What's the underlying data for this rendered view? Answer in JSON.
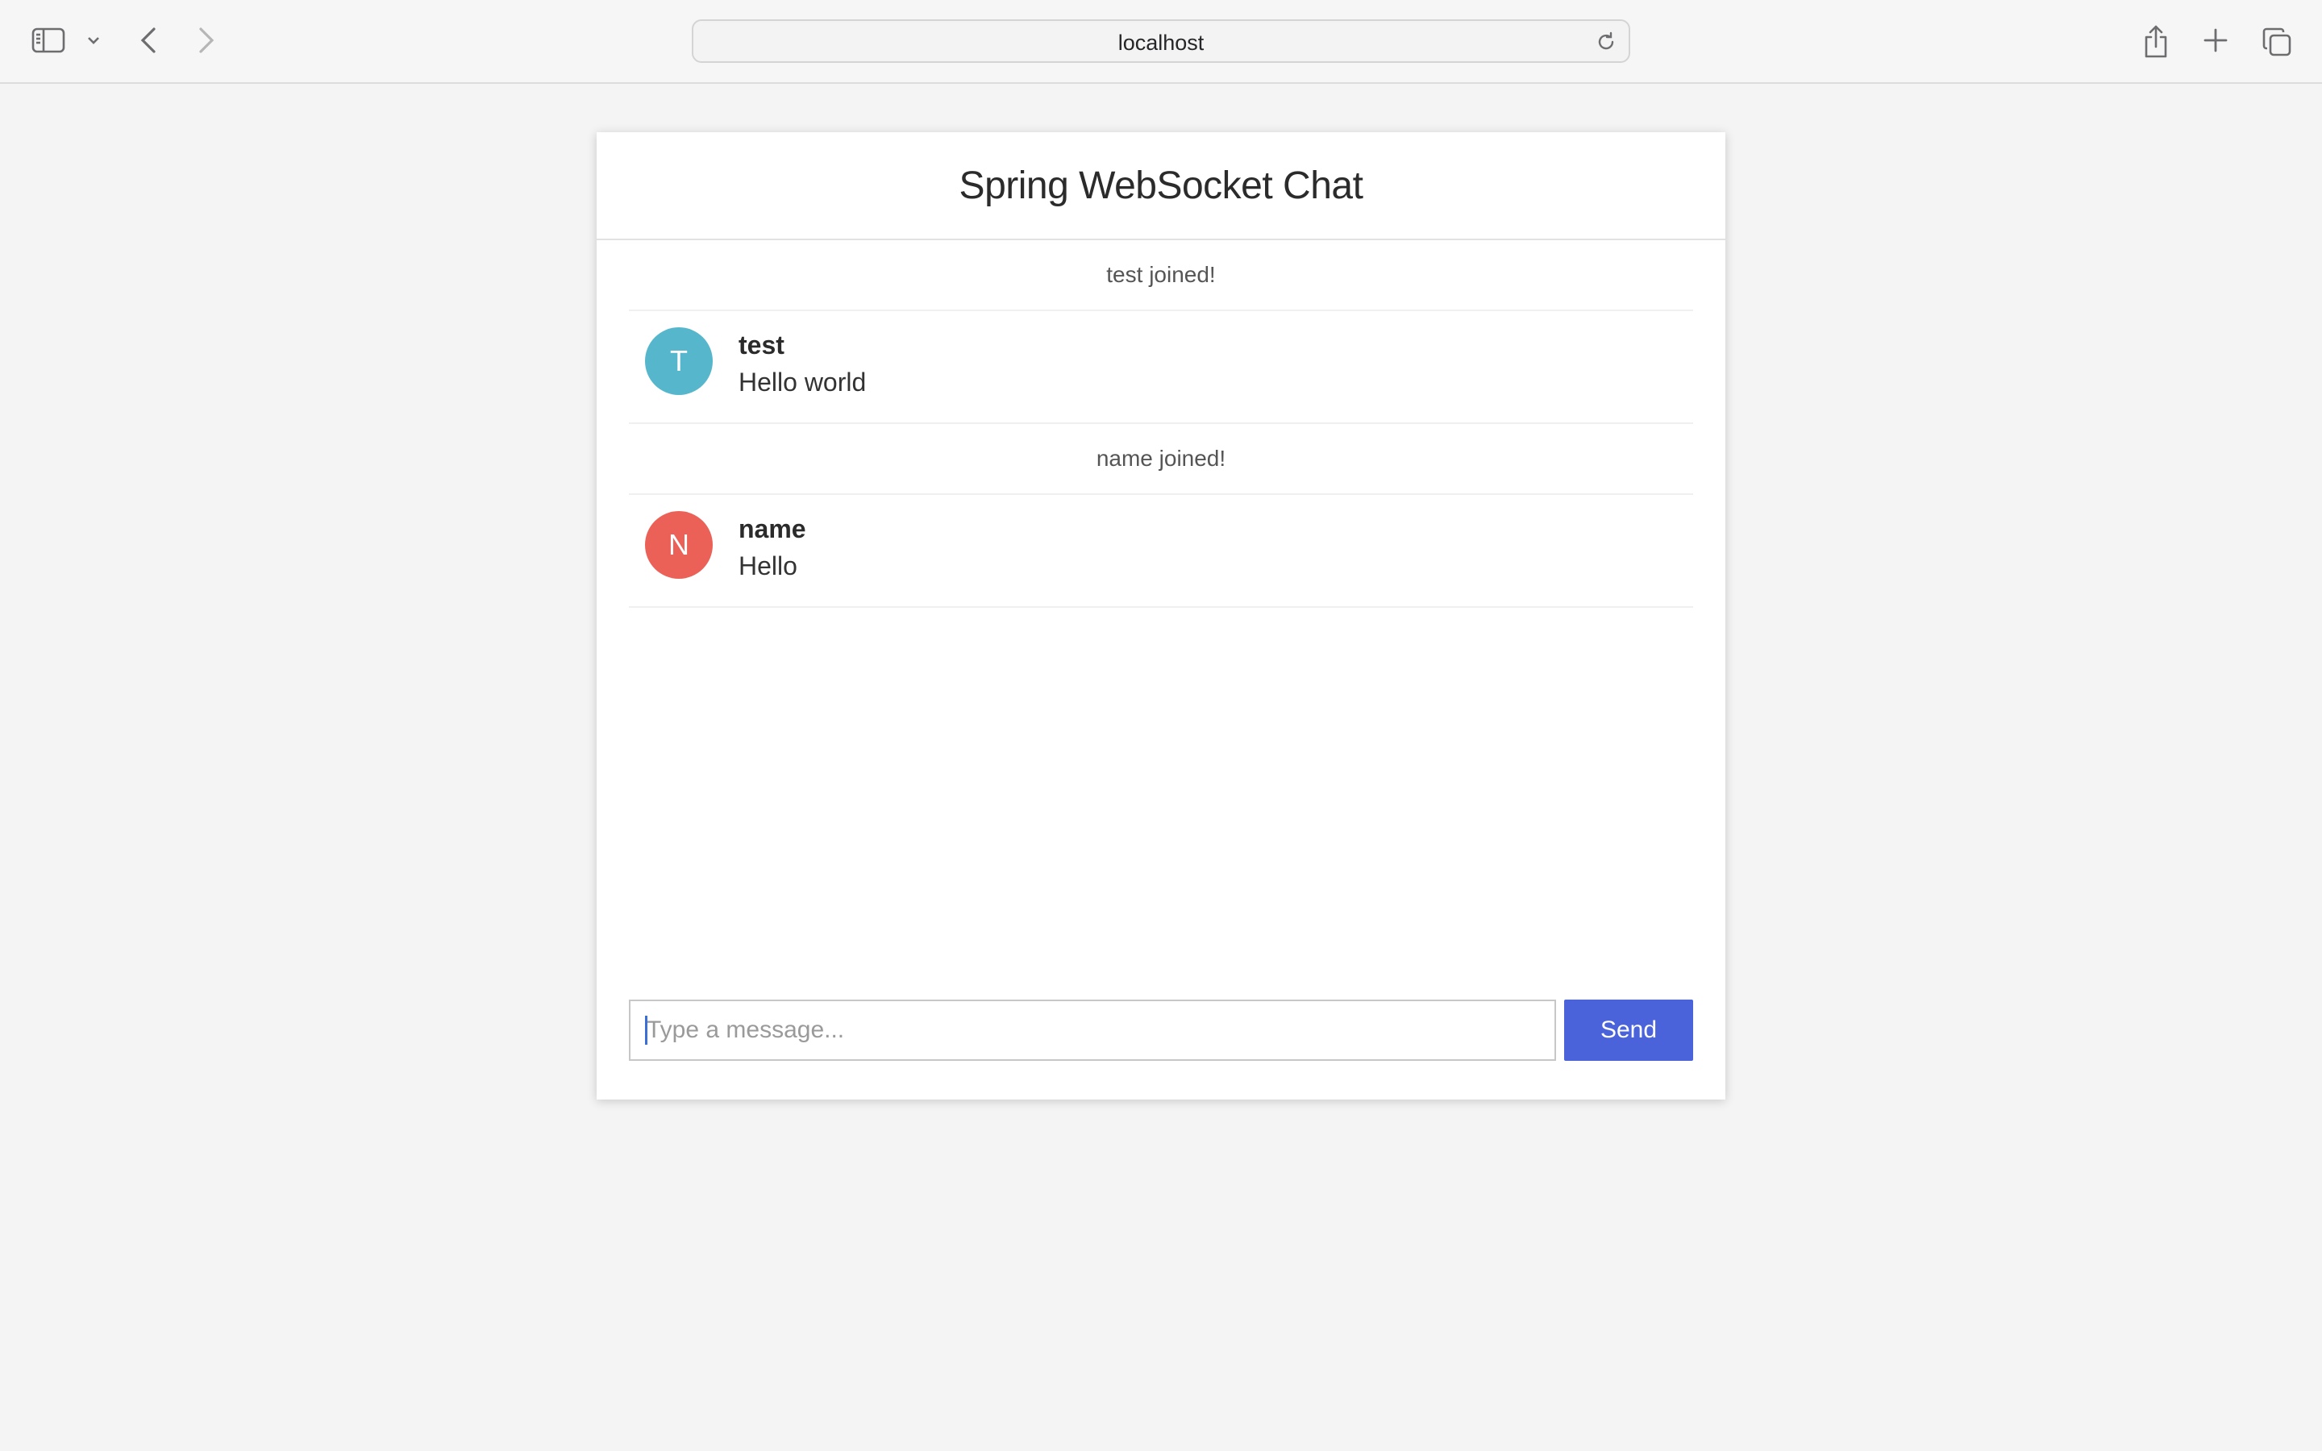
{
  "browser": {
    "address": "localhost"
  },
  "chat": {
    "title": "Spring WebSocket Chat",
    "messages": [
      {
        "type": "event",
        "text": "test joined!"
      },
      {
        "type": "chat",
        "sender": "test",
        "initial": "T",
        "avatar_color": "#56b7cc",
        "text": "Hello world"
      },
      {
        "type": "event",
        "text": "name joined!"
      },
      {
        "type": "chat",
        "sender": "name",
        "initial": "N",
        "avatar_color": "#ec6157",
        "text": "Hello"
      }
    ],
    "input": {
      "placeholder": "Type a message...",
      "value": ""
    },
    "send_label": "Send"
  },
  "colors": {
    "send_button": "#4a63db",
    "page_background": "#f4f4f4"
  }
}
